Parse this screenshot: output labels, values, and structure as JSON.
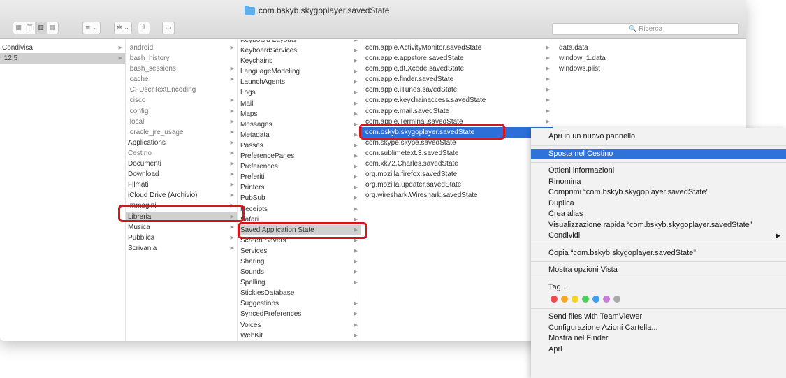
{
  "window": {
    "title": "com.bskyb.skygoplayer.savedState"
  },
  "toolbar": {
    "view_icon": "icon-view",
    "list_icon": "list-view",
    "column_icon": "column-view",
    "cover_icon": "cover-flow",
    "arrange": "≡ ⌄",
    "action": "✲ ⌄",
    "share": "⇧",
    "tag": "▭"
  },
  "search": {
    "placeholder": "Ricerca",
    "icon": "🔍"
  },
  "columns": {
    "col1": [
      {
        "label": "Condivisa",
        "arrow": true
      },
      {
        "label": ":12.5",
        "arrow": true,
        "selected": true
      }
    ],
    "col2": [
      {
        "label": ".android",
        "arrow": true,
        "grey": true
      },
      {
        "label": ".bash_history",
        "grey": true
      },
      {
        "label": ".bash_sessions",
        "arrow": true,
        "grey": true
      },
      {
        "label": ".cache",
        "arrow": true,
        "grey": true
      },
      {
        "label": ".CFUserTextEncoding",
        "grey": true
      },
      {
        "label": ".cisco",
        "arrow": true,
        "grey": true
      },
      {
        "label": ".config",
        "arrow": true,
        "grey": true
      },
      {
        "label": ".local",
        "arrow": true,
        "grey": true
      },
      {
        "label": ".oracle_jre_usage",
        "arrow": true,
        "grey": true
      },
      {
        "label": "Applications",
        "arrow": true
      },
      {
        "label": "Cestino",
        "arrow": true,
        "grey": true
      },
      {
        "label": "Documenti",
        "arrow": true
      },
      {
        "label": "Download",
        "arrow": true
      },
      {
        "label": "Filmati",
        "arrow": true
      },
      {
        "label": "iCloud Drive (Archivio)",
        "arrow": true
      },
      {
        "label": "Immagini",
        "arrow": true
      },
      {
        "label": "Libreria",
        "arrow": true,
        "selected": true
      },
      {
        "label": "Musica",
        "arrow": true
      },
      {
        "label": "Pubblica",
        "arrow": true
      },
      {
        "label": "Scrivania",
        "arrow": true
      }
    ],
    "col3": [
      {
        "label": "Keyboard Layouts",
        "arrow": true
      },
      {
        "label": "KeyboardServices",
        "arrow": true
      },
      {
        "label": "Keychains",
        "arrow": true
      },
      {
        "label": "LanguageModeling",
        "arrow": true
      },
      {
        "label": "LaunchAgents",
        "arrow": true
      },
      {
        "label": "Logs",
        "arrow": true
      },
      {
        "label": "Mail",
        "arrow": true
      },
      {
        "label": "Maps",
        "arrow": true
      },
      {
        "label": "Messages",
        "arrow": true
      },
      {
        "label": "Metadata",
        "arrow": true
      },
      {
        "label": "Passes",
        "arrow": true
      },
      {
        "label": "PreferencePanes",
        "arrow": true
      },
      {
        "label": "Preferences",
        "arrow": true
      },
      {
        "label": "Preferiti",
        "arrow": true
      },
      {
        "label": "Printers",
        "arrow": true
      },
      {
        "label": "PubSub",
        "arrow": true
      },
      {
        "label": "Receipts",
        "arrow": true
      },
      {
        "label": "Safari",
        "arrow": true
      },
      {
        "label": "Saved Application State",
        "arrow": true,
        "selected": true
      },
      {
        "label": "Screen Savers",
        "arrow": true
      },
      {
        "label": "Services",
        "arrow": true
      },
      {
        "label": "Sharing",
        "arrow": true
      },
      {
        "label": "Sounds",
        "arrow": true
      },
      {
        "label": "Spelling",
        "arrow": true
      },
      {
        "label": "StickiesDatabase"
      },
      {
        "label": "Suggestions",
        "arrow": true
      },
      {
        "label": "SyncedPreferences",
        "arrow": true
      },
      {
        "label": "Voices",
        "arrow": true
      },
      {
        "label": "WebKit",
        "arrow": true
      }
    ],
    "col4": [
      {
        "label": "com.apple.ActivityMonitor.savedState",
        "arrow": true
      },
      {
        "label": "com.apple.appstore.savedState",
        "arrow": true
      },
      {
        "label": "com.apple.dt.Xcode.savedState",
        "arrow": true
      },
      {
        "label": "com.apple.finder.savedState",
        "arrow": true
      },
      {
        "label": "com.apple.iTunes.savedState",
        "arrow": true
      },
      {
        "label": "com.apple.keychainaccess.savedState",
        "arrow": true
      },
      {
        "label": "com.apple.mail.savedState",
        "arrow": true
      },
      {
        "label": "com.apple.Terminal.savedState",
        "arrow": true
      },
      {
        "label": "com.bskyb.skygoplayer.savedState",
        "arrow": true,
        "active": true
      },
      {
        "label": "com.skype.skype.savedState",
        "arrow": true
      },
      {
        "label": "com.sublimetext.3.savedState",
        "arrow": true
      },
      {
        "label": "com.xk72.Charles.savedState",
        "arrow": true
      },
      {
        "label": "org.mozilla.firefox.savedState",
        "arrow": true
      },
      {
        "label": "org.mozilla.updater.savedState",
        "arrow": true
      },
      {
        "label": "org.wireshark.Wireshark.savedState",
        "arrow": true
      }
    ],
    "col5": [
      {
        "label": "data.data"
      },
      {
        "label": "window_1.data"
      },
      {
        "label": "windows.plist"
      }
    ]
  },
  "context_menu": {
    "items": [
      {
        "label": "Apri in un nuovo pannello"
      },
      {
        "sep": true
      },
      {
        "label": "Sposta nel Cestino",
        "active": true
      },
      {
        "sep": true
      },
      {
        "label": "Ottieni informazioni"
      },
      {
        "label": "Rinomina"
      },
      {
        "label": "Comprimi “com.bskyb.skygoplayer.savedState”"
      },
      {
        "label": "Duplica"
      },
      {
        "label": "Crea alias"
      },
      {
        "label": "Visualizzazione rapida “com.bskyb.skygoplayer.savedState”"
      },
      {
        "label": "Condividi",
        "submenu": true
      },
      {
        "sep": true
      },
      {
        "label": "Copia “com.bskyb.skygoplayer.savedState”"
      },
      {
        "sep": true
      },
      {
        "label": "Mostra opzioni Vista"
      },
      {
        "sep": true
      },
      {
        "label": "Tag..."
      },
      {
        "tags": true
      },
      {
        "sep": true
      },
      {
        "label": "Send files with TeamViewer"
      },
      {
        "label": "Configurazione Azioni Cartella..."
      },
      {
        "label": "Mostra nel Finder"
      },
      {
        "label": "Apri"
      }
    ],
    "tag_colors": [
      "#f04848",
      "#f5a623",
      "#f5d323",
      "#4cd05a",
      "#3b9cf0",
      "#c77ddc",
      "#a8a8a8"
    ]
  },
  "colors": {
    "selection": "#2c6fd9",
    "highlight": "#d6141c"
  }
}
